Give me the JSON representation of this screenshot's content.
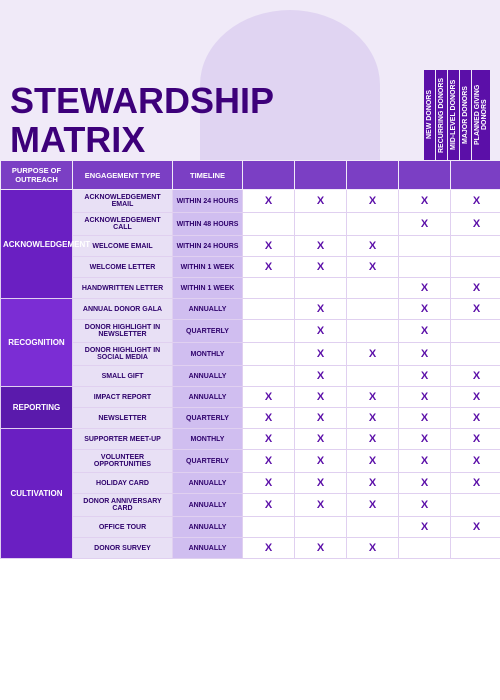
{
  "header": {
    "title_line1": "STEWARDSHIP",
    "title_line2": "MATRIX"
  },
  "columns": {
    "purpose_label": "PURPOSE OF OUTREACH",
    "engagement_label": "ENGAGEMENT TYPE",
    "timeline_label": "TIMELINE",
    "data_cols": [
      "NEW DONORS",
      "RECURRING DONORS",
      "MID-LEVEL DONORS",
      "MAJOR DONORS",
      "PLANNED GIVING DONORS"
    ]
  },
  "rows": [
    {
      "group": "ACKNOWLEDGEMENT",
      "engagement": "ACKNOWLEDGEMENT EMAIL",
      "timeline": "WITHIN 24 HOURS",
      "marks": [
        true,
        true,
        true,
        true,
        true
      ]
    },
    {
      "group": "",
      "engagement": "ACKNOWLEDGEMENT CALL",
      "timeline": "WITHIN 48 HOURS",
      "marks": [
        false,
        false,
        false,
        true,
        true
      ]
    },
    {
      "group": "",
      "engagement": "WELCOME EMAIL",
      "timeline": "WITHIN 24 HOURS",
      "marks": [
        true,
        true,
        true,
        false,
        false
      ]
    },
    {
      "group": "",
      "engagement": "WELCOME LETTER",
      "timeline": "WITHIN 1 WEEK",
      "marks": [
        true,
        true,
        true,
        false,
        false
      ]
    },
    {
      "group": "",
      "engagement": "HANDWRITTEN LETTER",
      "timeline": "WITHIN 1 WEEK",
      "marks": [
        false,
        false,
        false,
        true,
        true
      ]
    },
    {
      "group": "RECOGNITION",
      "engagement": "ANNUAL DONOR GALA",
      "timeline": "ANNUALLY",
      "marks": [
        false,
        true,
        false,
        true,
        true
      ]
    },
    {
      "group": "",
      "engagement": "DONOR HIGHLIGHT IN NEWSLETTER",
      "timeline": "QUARTERLY",
      "marks": [
        false,
        true,
        false,
        true,
        false
      ]
    },
    {
      "group": "",
      "engagement": "DONOR HIGHLIGHT IN SOCIAL MEDIA",
      "timeline": "MONTHLY",
      "marks": [
        false,
        true,
        true,
        true,
        false
      ]
    },
    {
      "group": "",
      "engagement": "SMALL GIFT",
      "timeline": "ANNUALLY",
      "marks": [
        false,
        true,
        false,
        true,
        true
      ]
    },
    {
      "group": "REPORTING",
      "engagement": "IMPACT REPORT",
      "timeline": "ANNUALLY",
      "marks": [
        true,
        true,
        true,
        true,
        true
      ]
    },
    {
      "group": "",
      "engagement": "NEWSLETTER",
      "timeline": "QUARTERLY",
      "marks": [
        true,
        true,
        true,
        true,
        true
      ]
    },
    {
      "group": "CULTIVATION",
      "engagement": "SUPPORTER MEET-UP",
      "timeline": "MONTHLY",
      "marks": [
        true,
        true,
        true,
        true,
        true
      ]
    },
    {
      "group": "",
      "engagement": "VOLUNTEER OPPORTUNITIES",
      "timeline": "QUARTERLY",
      "marks": [
        true,
        true,
        true,
        true,
        true
      ]
    },
    {
      "group": "",
      "engagement": "HOLIDAY CARD",
      "timeline": "ANNUALLY",
      "marks": [
        true,
        true,
        true,
        true,
        true
      ]
    },
    {
      "group": "",
      "engagement": "DONOR ANNIVERSARY CARD",
      "timeline": "ANNUALLY",
      "marks": [
        true,
        true,
        true,
        true,
        false
      ]
    },
    {
      "group": "",
      "engagement": "OFFICE TOUR",
      "timeline": "ANNUALLY",
      "marks": [
        false,
        false,
        false,
        true,
        true
      ]
    },
    {
      "group": "",
      "engagement": "DONOR SURVEY",
      "timeline": "ANNUALLY",
      "marks": [
        true,
        true,
        true,
        false,
        false
      ]
    }
  ]
}
